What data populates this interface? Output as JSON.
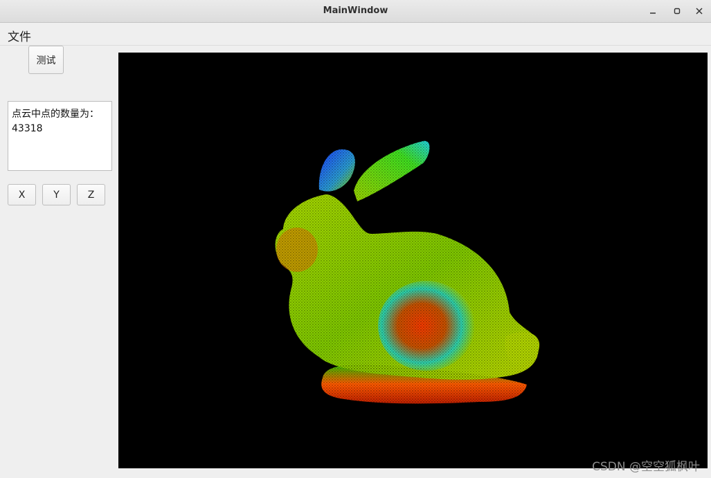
{
  "window": {
    "title": "MainWindow"
  },
  "menu": {
    "items": [
      "文件"
    ]
  },
  "sidebar": {
    "test_button": "测试",
    "info_line1": "点云中点的数量为：",
    "info_line2": "43318",
    "axis_buttons": [
      "X",
      "Y",
      "Z"
    ]
  },
  "viewer": {
    "background": "#000000",
    "subject": "bunny-point-cloud",
    "colormap": "rainbow"
  },
  "watermark": "CSDN @空空狐枫叶"
}
